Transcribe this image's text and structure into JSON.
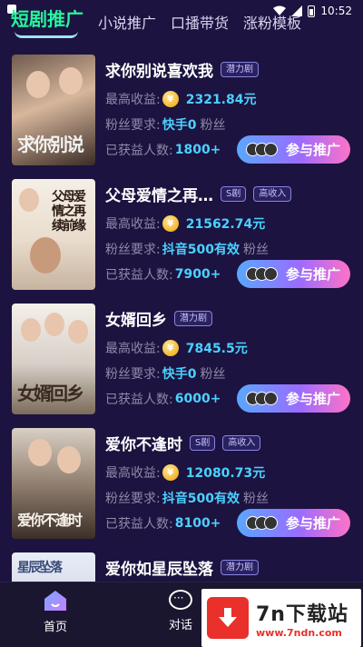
{
  "status_bar": {
    "time": "10:52"
  },
  "tabs": [
    {
      "label": "短剧推广",
      "active": true
    },
    {
      "label": "小说推广",
      "active": false
    },
    {
      "label": "口播带货",
      "active": false
    },
    {
      "label": "涨粉模板",
      "active": false
    }
  ],
  "labels": {
    "max_income": "最高收益:",
    "fan_req": "粉丝要求:",
    "earned": "已获益人数:",
    "fans_suffix": "粉丝",
    "join": "参与推广",
    "coin": "¥"
  },
  "items": [
    {
      "title": "求你别说喜欢我",
      "badges": [
        "潜力剧"
      ],
      "max_income": "2321.84元",
      "fan_requirement": "快手0",
      "earned_count": "1800+",
      "poster_text": "求你别说"
    },
    {
      "title": "父母爱情之再…",
      "badges": [
        "S剧",
        "高收入"
      ],
      "max_income": "21562.74元",
      "fan_requirement": "抖音500有效",
      "earned_count": "7900+",
      "poster_text": "父母爱情之再续前缘"
    },
    {
      "title": "女婿回乡",
      "badges": [
        "潜力剧"
      ],
      "max_income": "7845.5元",
      "fan_requirement": "快手0",
      "earned_count": "6000+",
      "poster_text": "女婿回乡"
    },
    {
      "title": "爱你不逢时",
      "badges": [
        "S剧",
        "高收入"
      ],
      "max_income": "12080.73元",
      "fan_requirement": "抖音500有效",
      "earned_count": "8100+",
      "poster_text": "爱你不逢时"
    },
    {
      "title": "爱你如星辰坠落",
      "badges": [
        "潜力剧"
      ],
      "poster_text": "星辰坠落"
    }
  ],
  "bottom_nav": {
    "home": "首页",
    "chat": "对话"
  },
  "watermark": {
    "name": "7n下载站",
    "url": "www.7ndn.com"
  },
  "colors": {
    "background": "#1c1340",
    "active_tab": "#27f59d",
    "value": "#4bd1ff",
    "coin": "#f3b62d",
    "button_gradient": [
      "#5aa7ff",
      "#9a6cff",
      "#ff72c7"
    ]
  }
}
